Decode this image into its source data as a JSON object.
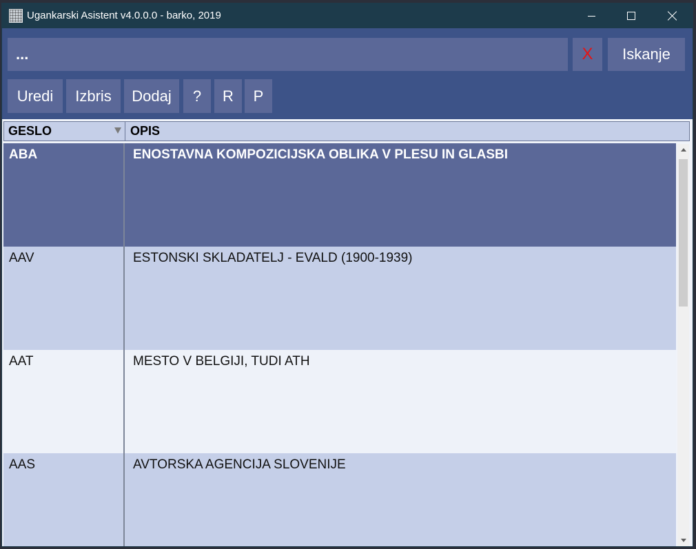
{
  "window": {
    "title": "Ugankarski Asistent v4.0.0.0 - barko, 2019",
    "icon": "app-grid-icon",
    "controls": {
      "minimize": "minimize-icon",
      "maximize": "maximize-icon",
      "close": "close-icon"
    }
  },
  "search": {
    "value": "...",
    "clear_label": "X",
    "search_label": "Iskanje"
  },
  "toolbar": {
    "uredi": "Uredi",
    "izbris": "Izbris",
    "dodaj": "Dodaj",
    "help": "?",
    "r": "R",
    "p": "P"
  },
  "table": {
    "columns": [
      "GESLO",
      "OPIS"
    ],
    "sorted_column": "GESLO",
    "rows": [
      {
        "geslo": "ABA",
        "opis": "ENOSTAVNA KOMPOZICIJSKA OBLIKA V PLESU IN GLASBI",
        "selected": true
      },
      {
        "geslo": "AAV",
        "opis": "ESTONSKI SKLADATELJ - EVALD (1900-1939)"
      },
      {
        "geslo": "AAT",
        "opis": "MESTO V BELGIJI, TUDI ATH"
      },
      {
        "geslo": "AAS",
        "opis": "AVTORSKA AGENCIJA SLOVENIJE"
      }
    ]
  },
  "colors": {
    "titlebar": "#1d3b4b",
    "window_bg": "#3d5388",
    "button_bg": "#5b6898",
    "selected_row": "#5b6898",
    "alt_row": "#c5cfe8",
    "plain_row": "#eef2f9",
    "clear_x": "#e51414"
  }
}
